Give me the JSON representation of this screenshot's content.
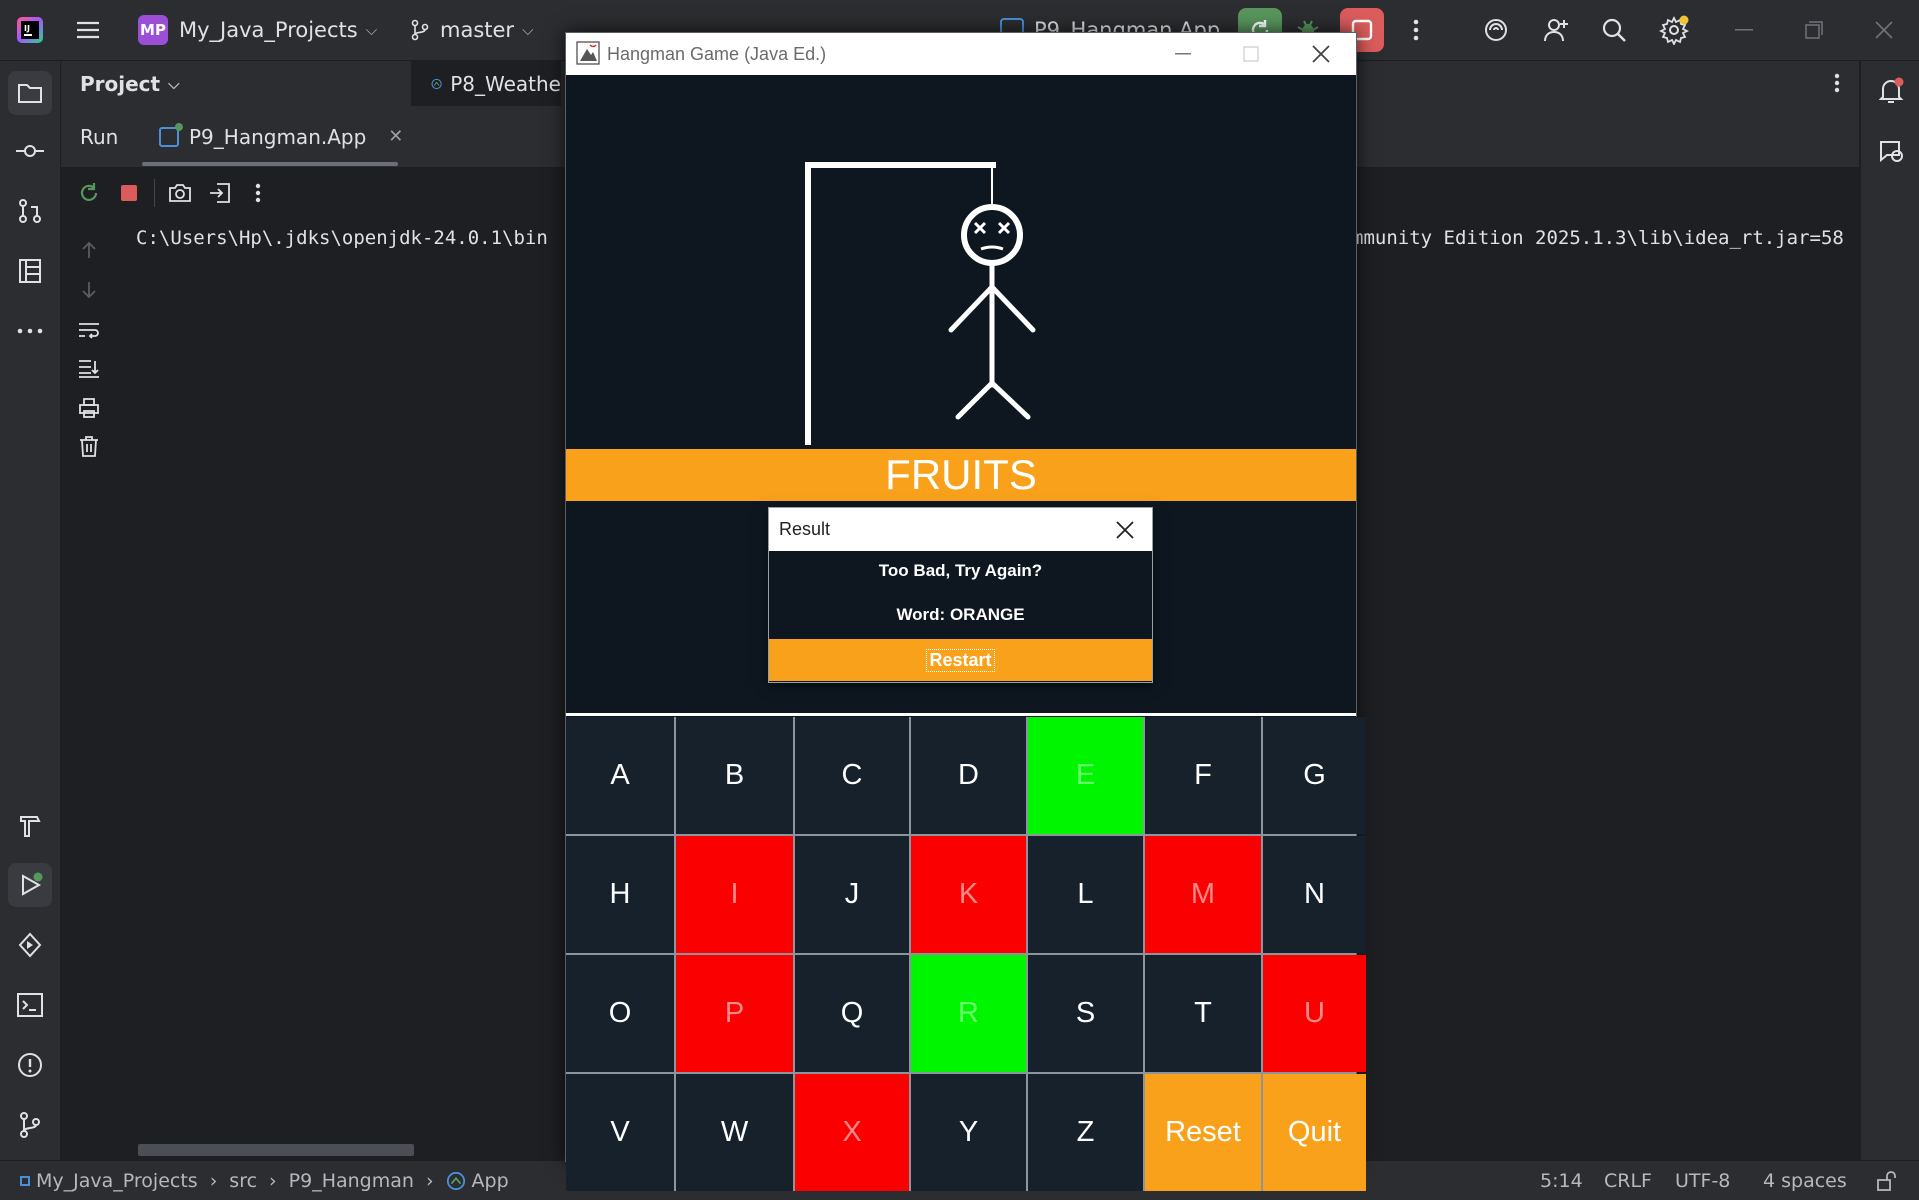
{
  "ide": {
    "project_badge": "MP",
    "project_name": "My_Java_Projects",
    "branch": "master",
    "run_config": "P9_Hangman.App",
    "project_panel_title": "Project",
    "editor_tab": "P8_Weathe",
    "run_label": "Run",
    "run_tab": "P9_Hangman.App",
    "console_left": "C:\\Users\\Hp\\.jdks\\openjdk-24.0.1\\bin",
    "console_right": "mmunity Edition 2025.1.3\\lib\\idea_rt.jar=58"
  },
  "statusbar": {
    "breadcrumbs": [
      "My_Java_Projects",
      "src",
      "P9_Hangman",
      "App"
    ],
    "position": "5:14",
    "line_ending": "CRLF",
    "encoding": "UTF-8",
    "indent": "4 spaces"
  },
  "game": {
    "title": "Hangman Game (Java Ed.)",
    "category": "FRUITS",
    "keys": [
      {
        "label": "A",
        "state": "unused"
      },
      {
        "label": "B",
        "state": "unused"
      },
      {
        "label": "C",
        "state": "unused"
      },
      {
        "label": "D",
        "state": "unused"
      },
      {
        "label": "E",
        "state": "right"
      },
      {
        "label": "F",
        "state": "unused"
      },
      {
        "label": "G",
        "state": "unused"
      },
      {
        "label": "H",
        "state": "unused"
      },
      {
        "label": "I",
        "state": "wrong"
      },
      {
        "label": "J",
        "state": "unused"
      },
      {
        "label": "K",
        "state": "wrong"
      },
      {
        "label": "L",
        "state": "unused"
      },
      {
        "label": "M",
        "state": "wrong"
      },
      {
        "label": "N",
        "state": "unused"
      },
      {
        "label": "O",
        "state": "unused"
      },
      {
        "label": "P",
        "state": "wrong"
      },
      {
        "label": "Q",
        "state": "unused"
      },
      {
        "label": "R",
        "state": "right"
      },
      {
        "label": "S",
        "state": "unused"
      },
      {
        "label": "T",
        "state": "unused"
      },
      {
        "label": "U",
        "state": "wrong"
      },
      {
        "label": "V",
        "state": "unused"
      },
      {
        "label": "W",
        "state": "unused"
      },
      {
        "label": "X",
        "state": "wrong"
      },
      {
        "label": "Y",
        "state": "unused"
      },
      {
        "label": "Z",
        "state": "unused"
      },
      {
        "label": "Reset",
        "state": "action"
      },
      {
        "label": "Quit",
        "state": "action"
      }
    ]
  },
  "dialog": {
    "title": "Result",
    "message": "Too Bad, Try Again?",
    "word_line": "Word: ORANGE",
    "restart_label": "Restart"
  },
  "colors": {
    "accent_orange": "#f9a11b",
    "wrong_red": "#fb0000",
    "right_green": "#00f500",
    "game_bg": "#0e1720"
  }
}
